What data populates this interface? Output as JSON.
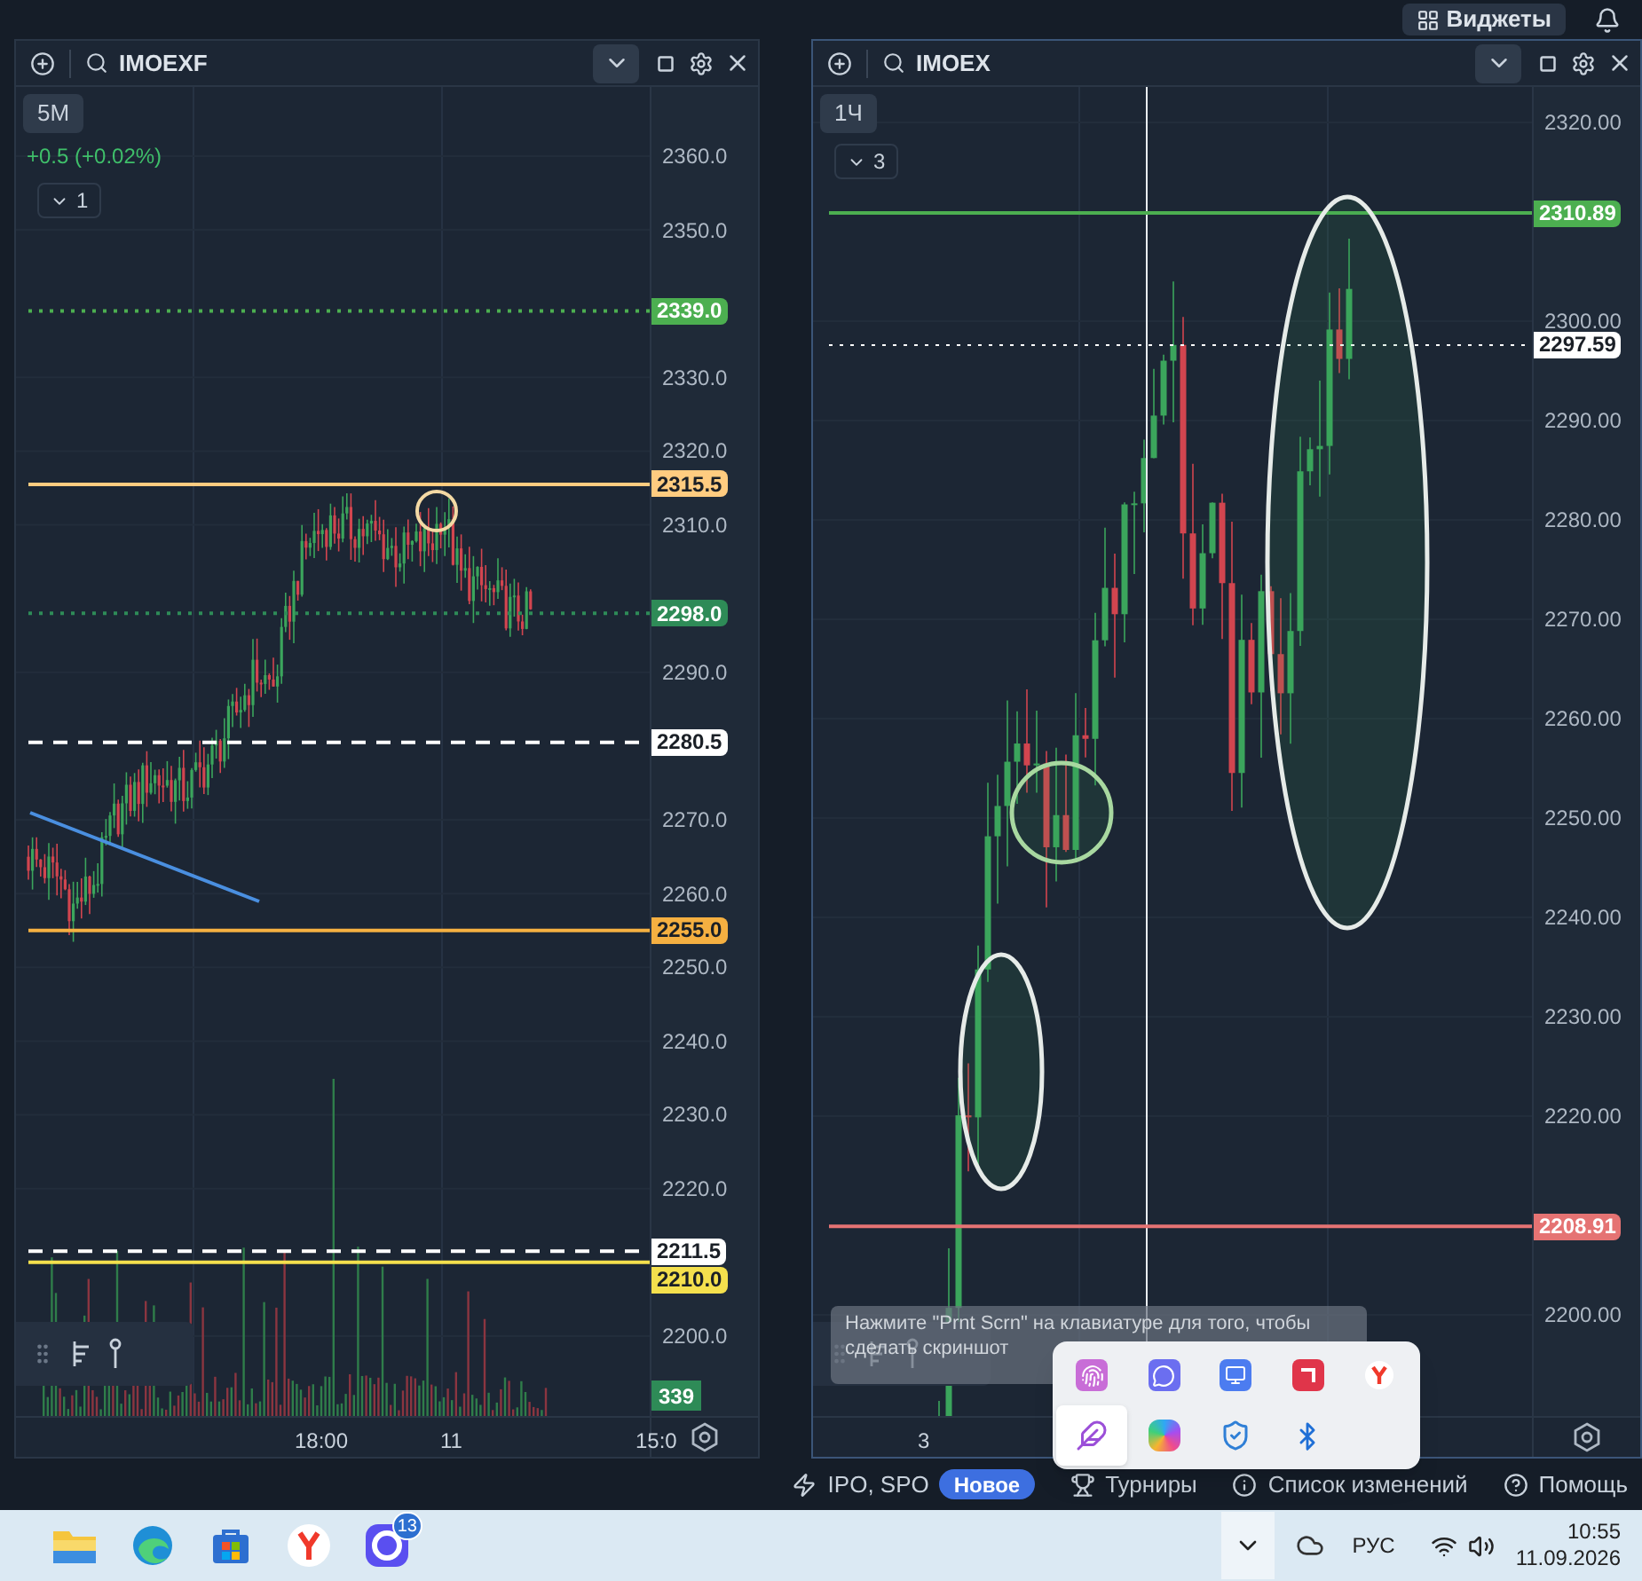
{
  "top_bar": {
    "widgets_button": "Виджеты"
  },
  "panels": [
    {
      "ticker": "IMOEXF",
      "interval": "5M",
      "change": "+0.5 (+0.02%)",
      "indicators": "1",
      "price_labels": [
        "2360.0",
        "2350.0",
        "2330.0",
        "2320.0",
        "2310.0",
        "2290.0",
        "2270.0",
        "2260.0",
        "2250.0",
        "2240.0",
        "2230.0",
        "2220.0",
        "2200.0"
      ],
      "levels": [
        {
          "label": "2339.0",
          "color": "#4caf50",
          "kind": "dotted"
        },
        {
          "label": "2315.5",
          "color": "#ffcc80",
          "kind": "solid"
        },
        {
          "label": "2298.0",
          "color": "#2e8b57",
          "kind": "dotted"
        },
        {
          "label": "2280.5",
          "color": "#ffffff",
          "kind": "dashed"
        },
        {
          "label": "2255.0",
          "color": "#f5b041",
          "kind": "solid"
        },
        {
          "label": "2211.5",
          "color": "#ffffff",
          "kind": "dashed"
        },
        {
          "label": "2210.0",
          "color": "#f4e04d",
          "kind": "solid"
        }
      ],
      "volume_tag": "339",
      "time_labels": [
        "18:00",
        "11",
        "15:0"
      ]
    },
    {
      "ticker": "IMOEX",
      "interval": "1Ч",
      "indicators": "3",
      "price_labels": [
        "2320.00",
        "2300.00",
        "2290.00",
        "2280.00",
        "2270.00",
        "2260.00",
        "2250.00",
        "2240.00",
        "2230.00",
        "2220.00",
        "2200.00"
      ],
      "levels": [
        {
          "label": "2310.89",
          "color": "#4caf50",
          "kind": "solid"
        },
        {
          "label": "2297.59",
          "color": "#ffffff",
          "kind": "dotted"
        },
        {
          "label": "2208.91",
          "color": "#e57373",
          "kind": "solid"
        }
      ],
      "time_labels": [
        "3"
      ]
    }
  ],
  "status_bar": {
    "items": [
      {
        "kind": "ipo",
        "label": "IPO, SPO",
        "badge": "Новое"
      },
      {
        "kind": "tournaments",
        "label": "Турниры"
      },
      {
        "kind": "changelog",
        "label": "Список изменений"
      },
      {
        "kind": "help",
        "label": "Помощь"
      }
    ]
  },
  "toast": {
    "text": "Нажмите \"Prnt Scrn\" на клавиатуре для того, чтобы сделать скриншот"
  },
  "tray_popup": {
    "items": [
      {
        "kind": "fingerprint",
        "selected": false
      },
      {
        "kind": "chat",
        "selected": false
      },
      {
        "kind": "monitor",
        "selected": false
      },
      {
        "kind": "square-logo",
        "selected": false
      },
      {
        "kind": "y-logo",
        "selected": false
      },
      {
        "kind": "feather",
        "selected": true
      },
      {
        "kind": "colorful",
        "selected": false
      },
      {
        "kind": "shield",
        "selected": false
      },
      {
        "kind": "bluetooth",
        "selected": false
      }
    ]
  },
  "taskbar": {
    "apps": [
      {
        "kind": "folder"
      },
      {
        "kind": "browser"
      },
      {
        "kind": "store"
      },
      {
        "kind": "y-logo"
      },
      {
        "kind": "messenger",
        "badge": "13"
      }
    ],
    "language": "РУС",
    "time": "10:55",
    "date": "11.09.2026"
  }
}
